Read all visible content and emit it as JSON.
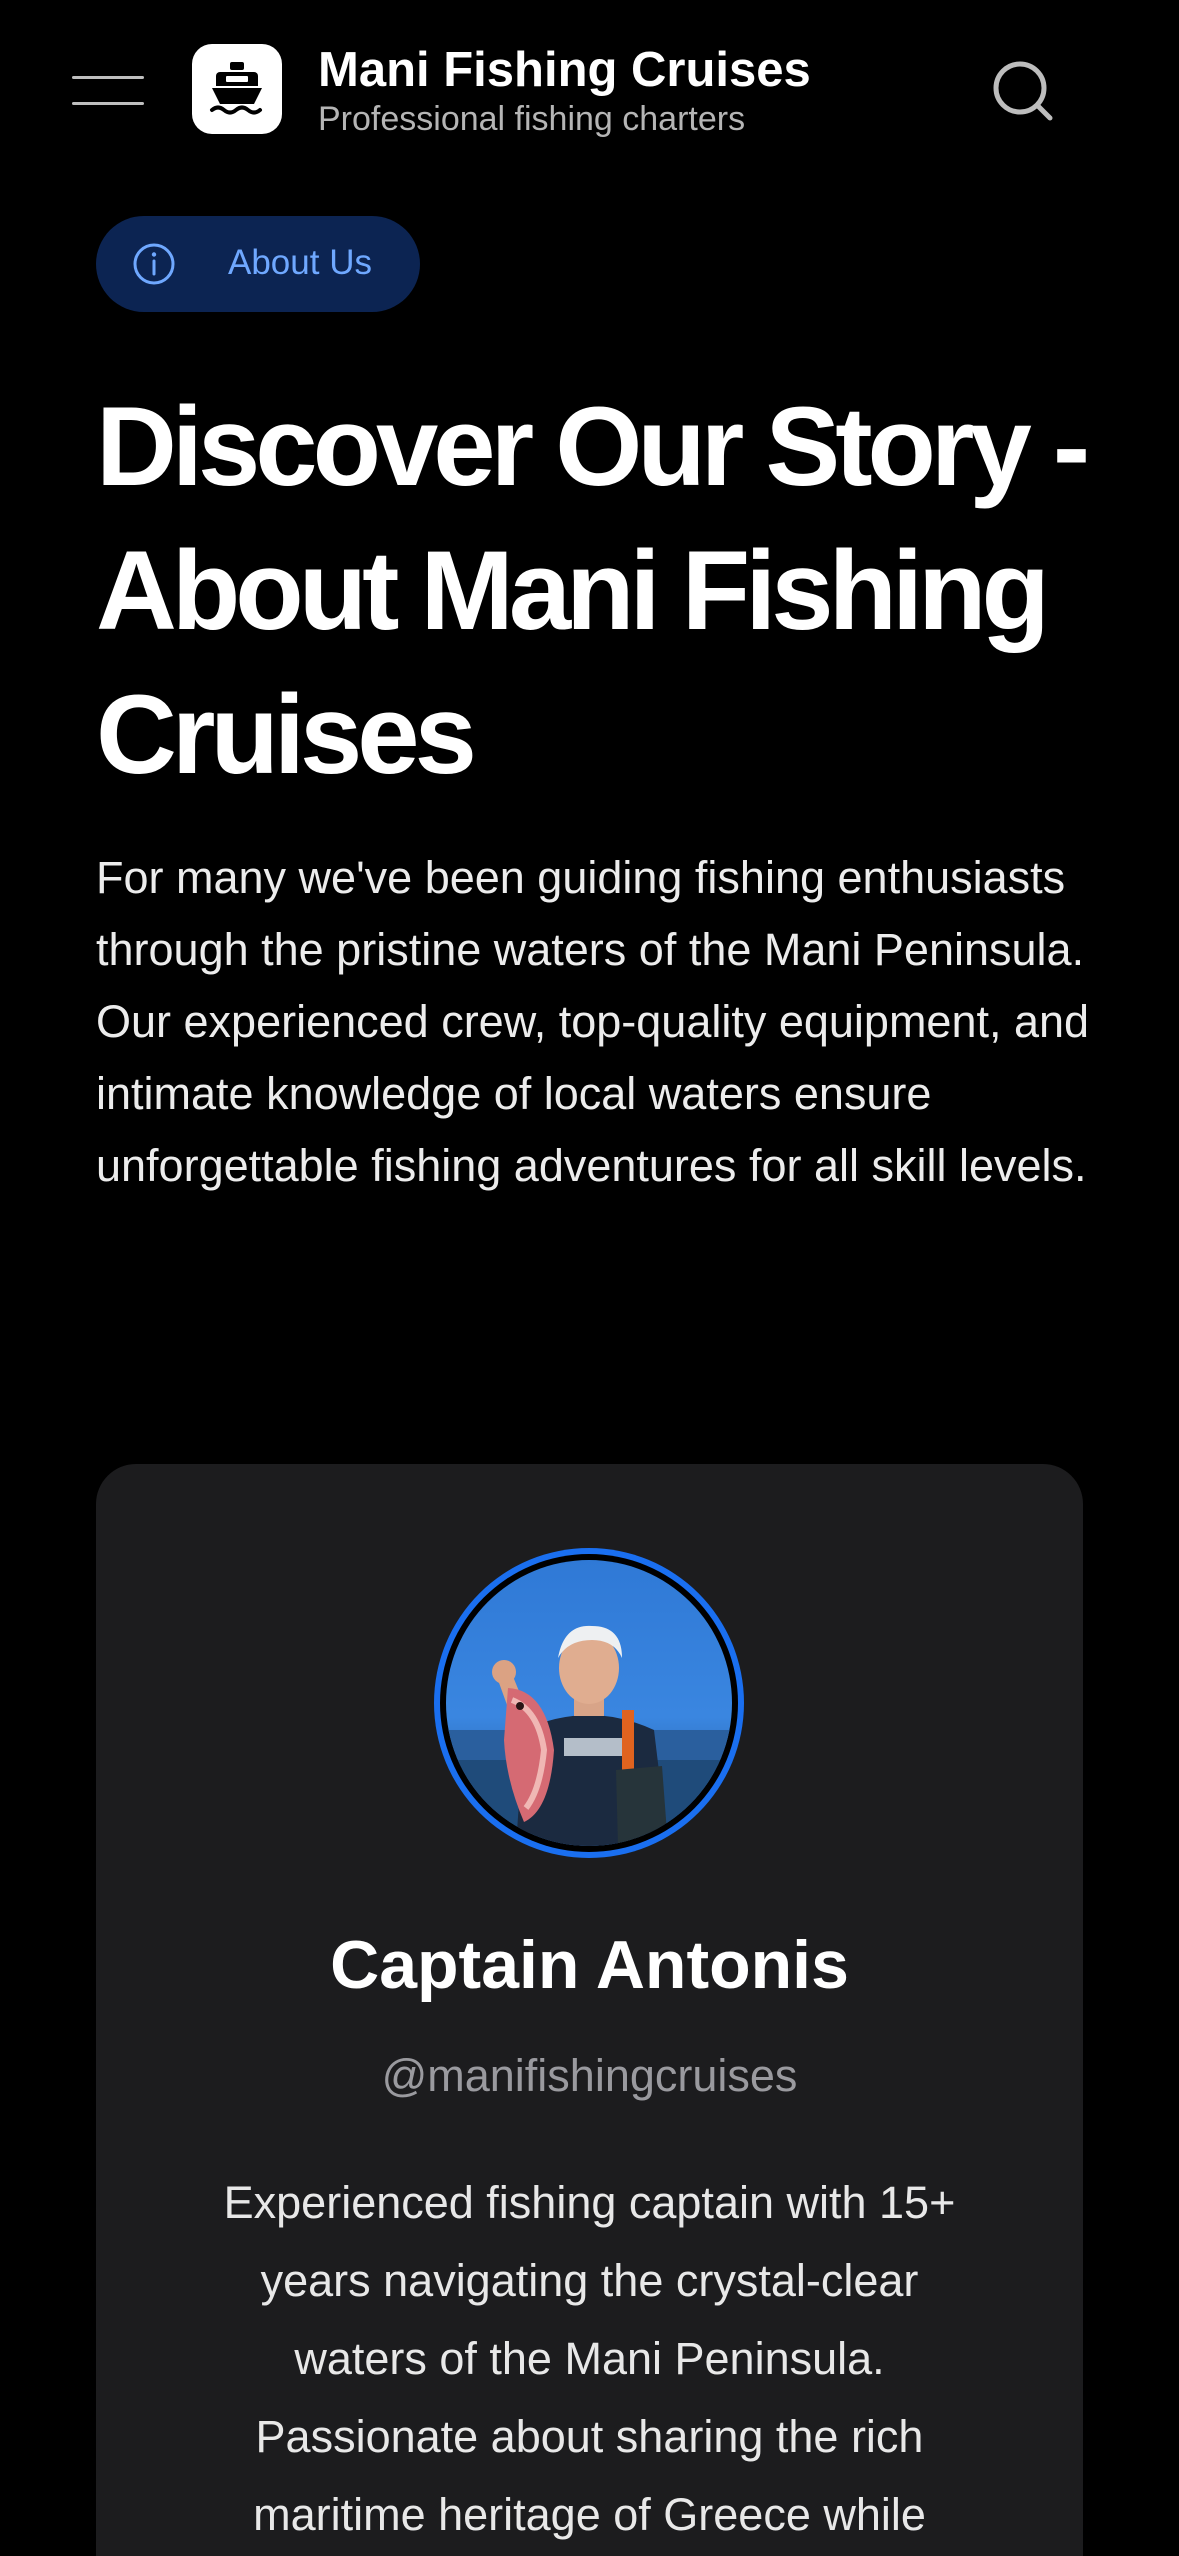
{
  "header": {
    "menu_icon": "hamburger-menu-icon",
    "logo_icon": "boat-icon",
    "title": "Mani Fishing Cruises",
    "subtitle": "Professional fishing charters",
    "search_icon": "search-icon"
  },
  "badge": {
    "icon": "info-icon",
    "label": "About Us",
    "color": "#6fa8ff",
    "background": "#0c2452"
  },
  "hero": {
    "title": "Discover Our Story - About Mani Fishing Cruises",
    "description": "For many we've been guiding fishing enthusiasts through the pristine waters of the Mani Peninsula. Our experienced crew, top-quality equipment, and intimate knowledge of local waters ensure unforgettable fishing adventures for all skill levels."
  },
  "profile_card": {
    "avatar": "captain-photo",
    "accent_color": "#1a6ff0",
    "name": "Captain Antonis",
    "handle": "@manifishingcruises",
    "bio": "Experienced fishing captain with 15+ years navigating the crystal-clear waters of the Mani Peninsula. Passionate about sharing the rich maritime heritage of Greece while"
  },
  "colors": {
    "background": "#000000",
    "card": "#1c1c1e",
    "muted_text": "#9a9a9f"
  }
}
